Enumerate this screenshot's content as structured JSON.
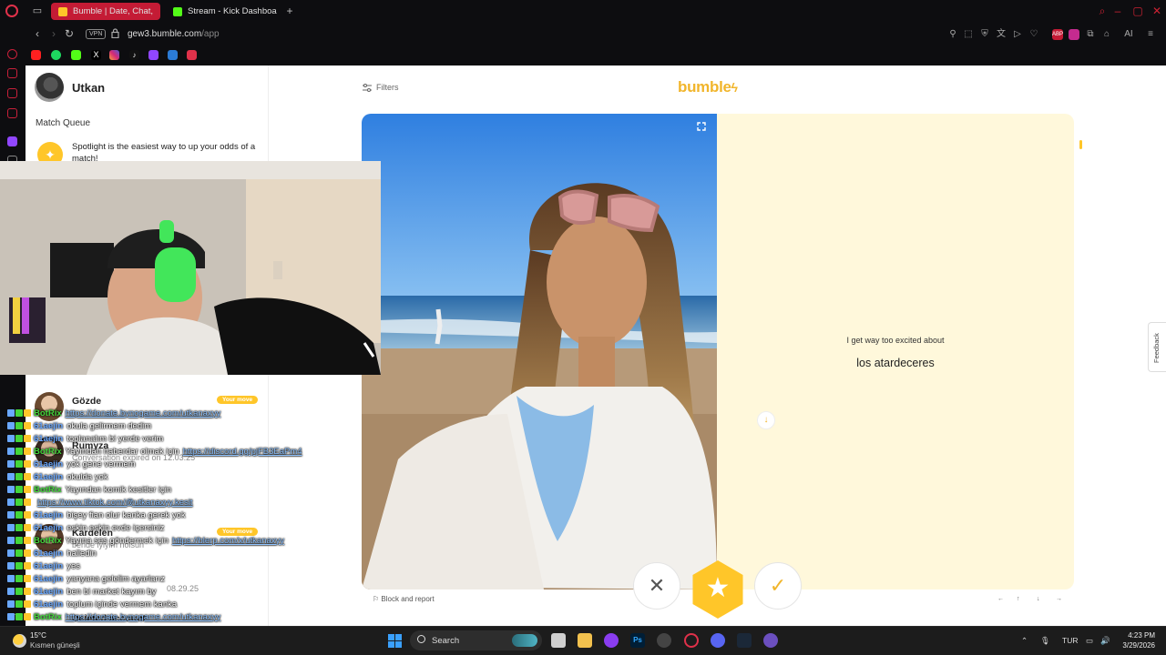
{
  "browser": {
    "tabs": [
      {
        "title": "Bumble | Date, Chat, Meet",
        "active": true
      },
      {
        "title": "Stream - Kick Dashboard",
        "active": false
      }
    ],
    "new_tab": "+",
    "vpn_label": "VPN",
    "url_host": "gew3.bumble.com",
    "url_path": "/app",
    "ai_label": "AI"
  },
  "sidebar": {
    "user_name": "Utkan",
    "match_queue_label": "Match Queue",
    "spotlight_text": "Spotlight is the easiest way to up your odds of a match!",
    "conversations": [
      {
        "name": "Gözde",
        "subtitle": "",
        "badge": "Your move"
      },
      {
        "name": "Rumyza",
        "subtitle": "Conversation expired on 12.03.25",
        "badge": ""
      },
      {
        "name": "Kardelen",
        "subtitle": "bende iyiyim nolsun",
        "badge": "Your move"
      },
      {
        "name": "",
        "subtitle": "08.29.25",
        "badge": ""
      },
      {
        "name": "Deleted account",
        "subtitle": "",
        "badge": ""
      }
    ]
  },
  "main": {
    "filters_label": "Filters",
    "logo_text": "bumble",
    "about_label": "I get way too excited about",
    "about_value": "los atardeceres",
    "block_report_label": "Block and report",
    "feedback_label": "Feedback",
    "actions": {
      "pass": "✕",
      "superswipe": "★",
      "like": "✓"
    },
    "kb_hints": [
      "←",
      "↑",
      "↓",
      "→"
    ]
  },
  "chat_overlay": [
    {
      "user": "BotRix",
      "msg": "https://donate.bynogame.com/utkanaxyy",
      "link": true
    },
    {
      "user": "61aejin",
      "msg": "okula gelirmem dedim",
      "link": false
    },
    {
      "user": "61aejin",
      "msg": "toplanalım bi yerde verim",
      "link": false
    },
    {
      "user": "BotRix",
      "msg": "Yayından haberdar olmak için",
      "link_text": "https://discord.gg/pjFB3EaPm4",
      "link": false
    },
    {
      "user": "61aejin",
      "msg": "yok gene vermem",
      "link": false
    },
    {
      "user": "61aejin",
      "msg": "okulda yok",
      "link": false
    },
    {
      "user": "BotRix",
      "msg": "Yayından komik kesitler için",
      "link": false
    },
    {
      "user": "",
      "msg": "https://www.tiktok.com/@utkanaxyy.kesit",
      "link": true
    },
    {
      "user": "61aejin",
      "msg": "bişey fian olur kanka gerek yok",
      "link": false
    },
    {
      "user": "61aejin",
      "msg": "eskin eskin evde içersiniz",
      "link": false
    },
    {
      "user": "BotRix",
      "msg": "Yayına ses göndermek için",
      "link_text": "https://blerp.com/x/utkanaxyy",
      "link": false
    },
    {
      "user": "61aejin",
      "msg": "halledin",
      "link": false
    },
    {
      "user": "61aejin",
      "msg": "yes",
      "link": false
    },
    {
      "user": "61aejin",
      "msg": "yanyana gelelim ayarlarız",
      "link": false
    },
    {
      "user": "61aejin",
      "msg": "ben bi market kayım by",
      "link": false
    },
    {
      "user": "61aejin",
      "msg": "toplum içinde vermem kanka",
      "link": false
    },
    {
      "user": "BotRix",
      "msg": "https://donate.bynogame.com/utkanaxyy",
      "link": true
    }
  ],
  "taskbar": {
    "temperature": "15°C",
    "weather": "Kısmen güneşli",
    "search_label": "Search",
    "language": "TUR",
    "time": "4:23 PM",
    "date": "3/29/2026"
  },
  "colors": {
    "bumble_yellow": "#ffc629",
    "opera_red": "#c41b35",
    "about_bg": "#fff8db",
    "botrix_green": "#43d63b",
    "user_blue": "#6aa8ff"
  }
}
